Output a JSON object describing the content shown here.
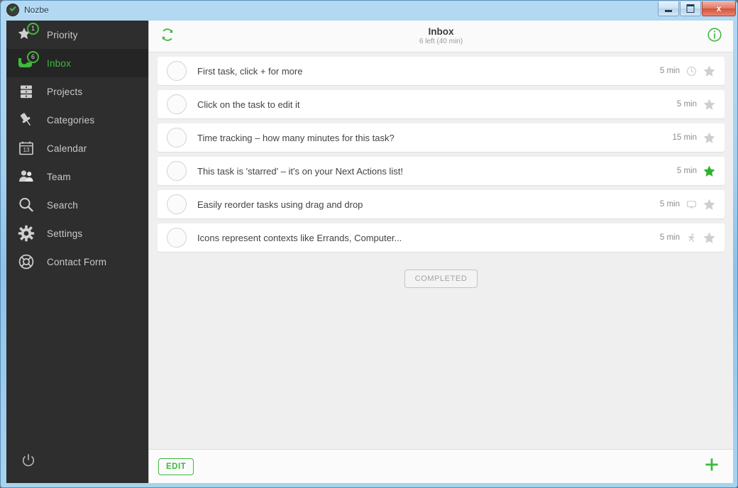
{
  "window": {
    "title": "Nozbe",
    "app_icon": "nozbe-check-icon",
    "controls": {
      "minimize": "minimize-button",
      "maximize": "maximize-button",
      "close_label": "x"
    }
  },
  "sidebar": {
    "items": [
      {
        "label": "Priority",
        "icon": "star-icon",
        "badge": "1",
        "active": false
      },
      {
        "label": "Inbox",
        "icon": "inbox-tray-icon",
        "badge": "6",
        "active": true
      },
      {
        "label": "Projects",
        "icon": "projects-stack-icon",
        "badge": "",
        "active": false
      },
      {
        "label": "Categories",
        "icon": "pushpin-icon",
        "badge": "",
        "active": false
      },
      {
        "label": "Calendar",
        "icon": "calendar-icon",
        "badge": "",
        "active": false,
        "calendar_day": "13"
      },
      {
        "label": "Team",
        "icon": "team-people-icon",
        "badge": "",
        "active": false
      },
      {
        "label": "Search",
        "icon": "search-magnifier-icon",
        "badge": "",
        "active": false
      },
      {
        "label": "Settings",
        "icon": "gear-icon",
        "badge": "",
        "active": false
      },
      {
        "label": "Contact Form",
        "icon": "lifebuoy-icon",
        "badge": "",
        "active": false
      }
    ],
    "power_icon": "power-icon"
  },
  "header": {
    "refresh_icon": "refresh-icon",
    "title": "Inbox",
    "subtitle": "6 left (40 min)",
    "info_icon": "info-icon"
  },
  "tasks": [
    {
      "title": "First task, click + for more",
      "time": "5 min",
      "context_icon": "clock-icon",
      "starred": false
    },
    {
      "title": "Click on the task to edit it",
      "time": "5 min",
      "context_icon": "",
      "starred": false
    },
    {
      "title": "Time tracking – how many minutes for this task?",
      "time": "15 min",
      "context_icon": "",
      "starred": false
    },
    {
      "title": "This task is 'starred' – it's on your Next Actions list!",
      "time": "5 min",
      "context_icon": "",
      "starred": true
    },
    {
      "title": "Easily reorder tasks using drag and drop",
      "time": "5 min",
      "context_icon": "monitor-icon",
      "starred": false
    },
    {
      "title": "Icons represent contexts like Errands, Computer...",
      "time": "5 min",
      "context_icon": "errands-running-icon",
      "starred": false
    }
  ],
  "completed": {
    "label": "COMPLETED"
  },
  "footer": {
    "edit_label": "EDIT",
    "add_icon": "plus-icon"
  },
  "colors": {
    "accent_green": "#3fb93f",
    "sidebar_bg": "#2e2e2e",
    "sidebar_active_bg": "#252525",
    "content_bg": "#efefef",
    "star_gray": "#cfcfcf"
  }
}
